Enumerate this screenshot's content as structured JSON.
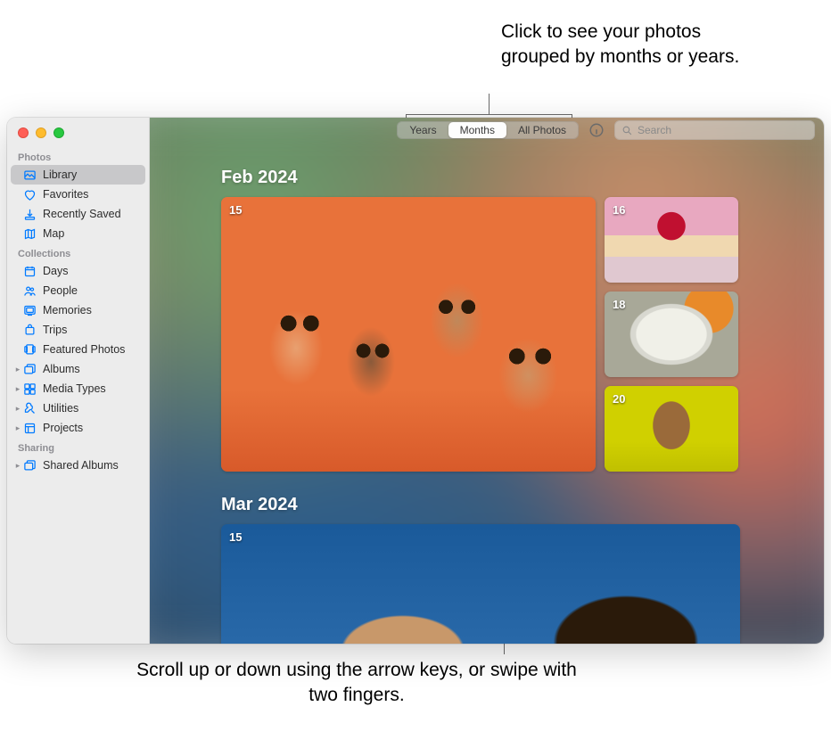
{
  "callouts": {
    "top": "Click to see your photos grouped by months or years.",
    "bottom": "Scroll up or down using the arrow keys, or swipe with two fingers."
  },
  "toolbar": {
    "segments": {
      "years": "Years",
      "months": "Months",
      "all": "All Photos"
    },
    "active_segment": "months",
    "search_placeholder": "Search"
  },
  "sidebar": {
    "sections": {
      "photos": {
        "label": "Photos",
        "items": [
          {
            "id": "library",
            "label": "Library",
            "icon": "library-icon",
            "selected": true
          },
          {
            "id": "favorites",
            "label": "Favorites",
            "icon": "heart-icon"
          },
          {
            "id": "recently-saved",
            "label": "Recently Saved",
            "icon": "download-icon"
          },
          {
            "id": "map",
            "label": "Map",
            "icon": "map-icon"
          }
        ]
      },
      "collections": {
        "label": "Collections",
        "items": [
          {
            "id": "days",
            "label": "Days",
            "icon": "calendar-icon"
          },
          {
            "id": "people",
            "label": "People",
            "icon": "people-icon"
          },
          {
            "id": "memories",
            "label": "Memories",
            "icon": "memories-icon"
          },
          {
            "id": "trips",
            "label": "Trips",
            "icon": "trips-icon"
          },
          {
            "id": "featured",
            "label": "Featured Photos",
            "icon": "featured-icon"
          },
          {
            "id": "albums",
            "label": "Albums",
            "icon": "albums-icon",
            "disclosure": true
          },
          {
            "id": "media-types",
            "label": "Media Types",
            "icon": "media-icon",
            "disclosure": true
          },
          {
            "id": "utilities",
            "label": "Utilities",
            "icon": "utilities-icon",
            "disclosure": true
          },
          {
            "id": "projects",
            "label": "Projects",
            "icon": "projects-icon",
            "disclosure": true
          }
        ]
      },
      "sharing": {
        "label": "Sharing",
        "items": [
          {
            "id": "shared-albums",
            "label": "Shared Albums",
            "icon": "shared-icon",
            "disclosure": true
          }
        ]
      }
    }
  },
  "content": {
    "months": [
      {
        "title": "Feb 2024",
        "tiles": [
          {
            "day": "15",
            "kind": "big"
          },
          {
            "day": "16",
            "kind": "small"
          },
          {
            "day": "18",
            "kind": "small"
          },
          {
            "day": "20",
            "kind": "small"
          }
        ]
      },
      {
        "title": "Mar 2024",
        "tiles": [
          {
            "day": "15",
            "kind": "full"
          }
        ]
      }
    ]
  }
}
